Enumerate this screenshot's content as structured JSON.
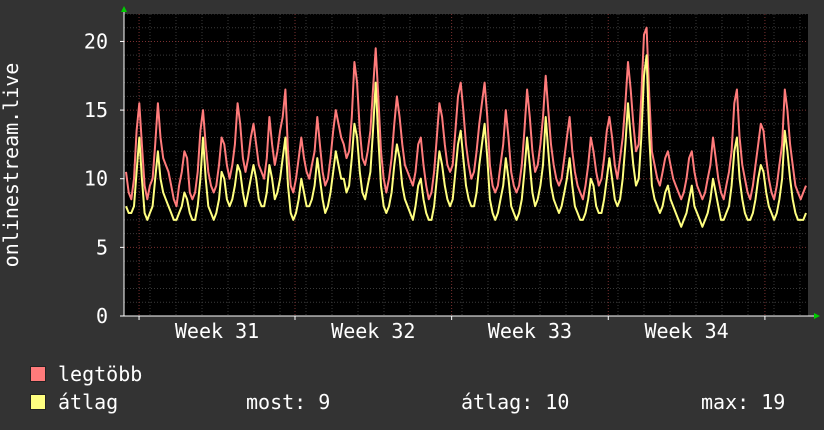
{
  "chart_data": {
    "type": "line",
    "ylabel": "onlinestream.live",
    "ylim": [
      0,
      22
    ],
    "yticks": [
      0,
      5,
      10,
      15,
      20
    ],
    "x_tick_labels": [
      "Week 31",
      "Week 32",
      "Week 33",
      "Week 34"
    ],
    "grid": true,
    "background": "#000000",
    "series": [
      {
        "name": "legtöbb",
        "color": "#ff7b7b",
        "values": [
          10.5,
          9.0,
          8.5,
          10.0,
          13.5,
          15.5,
          12.5,
          9.5,
          8.5,
          9.5,
          10.0,
          12.5,
          15.5,
          13.0,
          11.5,
          11.0,
          10.5,
          9.5,
          8.5,
          8.0,
          9.5,
          10.5,
          12.0,
          11.5,
          9.0,
          8.5,
          9.0,
          10.5,
          13.5,
          15.0,
          12.5,
          10.5,
          9.5,
          9.0,
          9.5,
          11.0,
          13.0,
          12.5,
          11.0,
          10.0,
          11.0,
          12.5,
          15.5,
          14.0,
          11.5,
          10.5,
          11.5,
          13.0,
          14.0,
          12.5,
          11.0,
          10.5,
          10.0,
          11.5,
          14.5,
          12.5,
          11.0,
          12.0,
          13.5,
          14.5,
          16.5,
          12.0,
          9.5,
          9.0,
          10.0,
          11.5,
          13.0,
          11.5,
          10.5,
          10.0,
          11.0,
          12.0,
          14.5,
          12.5,
          10.5,
          9.5,
          10.0,
          11.5,
          13.5,
          15.0,
          14.0,
          13.0,
          12.5,
          11.5,
          12.0,
          14.5,
          18.5,
          17.0,
          13.5,
          11.5,
          11.0,
          12.0,
          13.5,
          16.5,
          19.5,
          16.0,
          12.0,
          10.0,
          9.0,
          10.0,
          11.5,
          14.0,
          16.0,
          14.5,
          12.5,
          11.0,
          10.5,
          10.0,
          9.5,
          10.5,
          12.5,
          13.0,
          11.0,
          9.5,
          8.5,
          9.0,
          10.5,
          13.0,
          15.5,
          14.5,
          12.5,
          11.0,
          10.5,
          11.0,
          13.5,
          16.0,
          17.0,
          15.0,
          12.5,
          11.0,
          10.0,
          10.5,
          12.0,
          14.0,
          15.5,
          17.0,
          14.5,
          11.0,
          9.5,
          9.0,
          9.5,
          11.0,
          12.5,
          15.0,
          13.0,
          10.5,
          9.5,
          9.0,
          9.5,
          11.0,
          13.5,
          16.5,
          14.5,
          12.0,
          10.5,
          11.0,
          12.5,
          14.5,
          17.5,
          15.0,
          12.5,
          11.0,
          10.0,
          9.5,
          10.0,
          11.5,
          13.0,
          14.5,
          12.0,
          10.5,
          9.5,
          9.0,
          8.5,
          9.5,
          11.0,
          13.0,
          12.0,
          10.5,
          9.5,
          10.0,
          11.5,
          13.5,
          14.5,
          13.0,
          11.0,
          10.0,
          11.5,
          13.0,
          15.5,
          18.5,
          16.5,
          14.0,
          12.0,
          12.5,
          16.0,
          20.5,
          21.0,
          16.0,
          12.0,
          11.0,
          10.0,
          9.5,
          10.5,
          11.5,
          12.0,
          11.0,
          10.0,
          9.5,
          9.0,
          8.5,
          9.0,
          10.0,
          11.5,
          12.0,
          10.5,
          9.5,
          9.0,
          8.5,
          9.0,
          10.0,
          11.0,
          13.0,
          11.5,
          10.0,
          9.0,
          8.5,
          9.5,
          10.5,
          12.0,
          15.5,
          16.5,
          13.0,
          11.0,
          10.0,
          9.0,
          8.5,
          9.5,
          11.0,
          12.5,
          14.0,
          13.5,
          11.5,
          10.0,
          9.0,
          8.5,
          9.5,
          11.0,
          12.5,
          16.5,
          15.0,
          12.5,
          11.0,
          9.5,
          9.0,
          8.5,
          9.0,
          9.5
        ]
      },
      {
        "name": "átlag",
        "color": "#ffff80",
        "values": [
          8.0,
          7.5,
          7.5,
          8.0,
          10.5,
          13.0,
          10.0,
          7.5,
          7.0,
          7.5,
          8.0,
          10.0,
          12.0,
          10.0,
          9.0,
          8.5,
          8.0,
          7.5,
          7.0,
          7.0,
          7.5,
          8.0,
          9.0,
          8.5,
          7.5,
          7.0,
          7.0,
          8.0,
          10.0,
          13.0,
          10.0,
          8.0,
          7.5,
          7.0,
          7.5,
          8.5,
          10.5,
          10.0,
          8.5,
          8.0,
          8.5,
          9.5,
          11.0,
          10.5,
          9.0,
          8.0,
          9.0,
          10.0,
          11.0,
          10.0,
          8.5,
          8.0,
          8.0,
          9.0,
          11.0,
          10.0,
          8.5,
          9.0,
          10.0,
          11.5,
          13.0,
          9.5,
          7.5,
          7.0,
          7.5,
          8.5,
          10.0,
          9.0,
          8.0,
          8.0,
          8.5,
          9.5,
          11.5,
          10.0,
          8.5,
          7.5,
          8.0,
          9.0,
          10.5,
          12.0,
          11.0,
          10.0,
          10.0,
          9.0,
          9.5,
          11.5,
          14.0,
          13.0,
          10.5,
          9.0,
          8.5,
          9.5,
          10.5,
          13.5,
          17.0,
          13.0,
          9.5,
          8.0,
          7.5,
          8.0,
          9.0,
          11.0,
          12.5,
          11.5,
          9.5,
          8.5,
          8.0,
          7.5,
          7.0,
          8.0,
          9.5,
          10.0,
          8.5,
          7.5,
          7.0,
          7.0,
          8.0,
          10.0,
          12.0,
          11.0,
          9.5,
          8.5,
          8.0,
          8.5,
          10.5,
          12.5,
          13.5,
          11.5,
          9.5,
          8.5,
          8.0,
          8.0,
          9.0,
          11.0,
          12.5,
          14.0,
          11.5,
          8.5,
          7.5,
          7.0,
          7.5,
          8.5,
          9.5,
          11.5,
          10.0,
          8.0,
          7.5,
          7.0,
          7.5,
          8.5,
          10.5,
          13.0,
          11.0,
          9.0,
          8.0,
          8.5,
          9.5,
          11.0,
          14.5,
          12.0,
          9.5,
          8.5,
          8.0,
          7.5,
          8.0,
          9.0,
          10.0,
          11.5,
          9.5,
          8.0,
          7.5,
          7.0,
          7.0,
          7.5,
          8.5,
          10.0,
          9.5,
          8.0,
          7.5,
          7.5,
          8.5,
          10.0,
          11.5,
          10.0,
          8.5,
          8.0,
          8.5,
          10.0,
          12.5,
          15.5,
          13.0,
          11.0,
          9.5,
          10.0,
          13.0,
          17.5,
          19.0,
          13.0,
          9.5,
          8.5,
          8.0,
          7.5,
          8.0,
          9.0,
          9.5,
          8.5,
          8.0,
          7.5,
          7.0,
          6.5,
          7.0,
          7.5,
          8.5,
          9.5,
          8.0,
          7.5,
          7.0,
          6.5,
          7.0,
          7.5,
          8.5,
          10.0,
          9.0,
          8.0,
          7.0,
          7.0,
          7.5,
          8.0,
          9.5,
          12.0,
          13.0,
          10.0,
          8.5,
          7.5,
          7.0,
          7.0,
          7.5,
          8.5,
          10.0,
          11.0,
          10.5,
          9.0,
          8.0,
          7.5,
          7.0,
          7.5,
          8.5,
          10.0,
          13.5,
          12.0,
          10.0,
          8.5,
          7.5,
          7.0,
          7.0,
          7.0,
          7.5
        ]
      }
    ]
  },
  "legend": [
    {
      "label": "legtöbb",
      "color": "#ff7b7b"
    },
    {
      "label": "átlag",
      "color": "#ffff80"
    }
  ],
  "stats": {
    "most": "most: 9",
    "atlag": "átlag: 10",
    "max": "max: 19"
  }
}
